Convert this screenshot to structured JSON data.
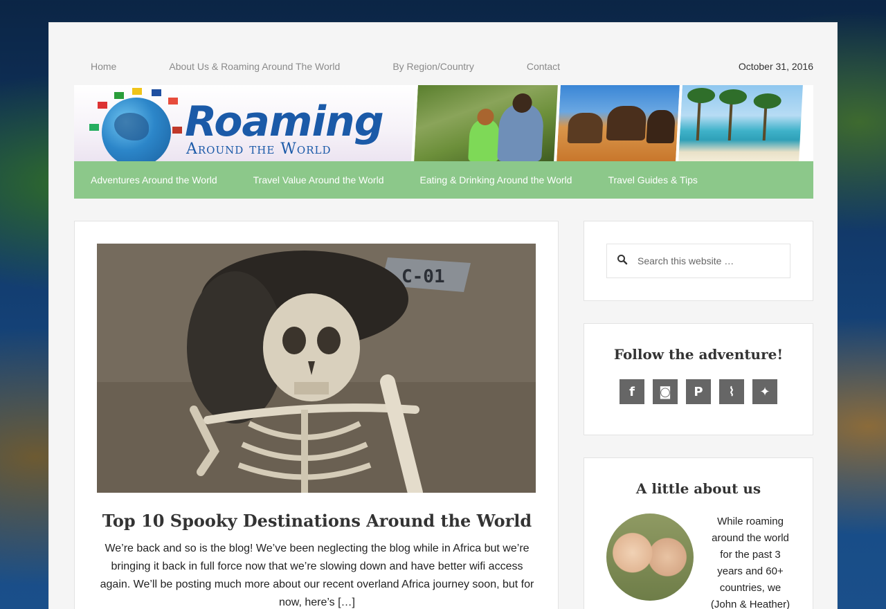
{
  "topnav": {
    "items": [
      "Home",
      "About Us & Roaming Around The World",
      "By Region/Country",
      "Contact"
    ],
    "date": "October 31, 2016"
  },
  "banner": {
    "logo_title": "Roaming",
    "logo_subtitle": "Around the World"
  },
  "mainnav": {
    "items": [
      "Adventures Around the World",
      "Travel Value Around the World",
      "Eating & Drinking Around the World",
      "Travel Guides & Tips"
    ]
  },
  "post": {
    "image_label": "C-01",
    "title": "Top 10 Spooky Destinations Around the World",
    "excerpt": "We’re back and so is the blog! We’ve been neglecting the blog while in Africa but we’re bringing it back in full force now that we’re slowing down and have better wifi access again. We’ll be posting much more about our recent overland Africa journey soon, but for now, here’s […]"
  },
  "sidebar": {
    "search": {
      "placeholder": "Search this website …",
      "icon": "search-icon"
    },
    "follow": {
      "title": "Follow the adventure!",
      "icons": [
        {
          "name": "facebook-icon",
          "glyph": "f"
        },
        {
          "name": "instagram-icon",
          "glyph": "◙"
        },
        {
          "name": "pinterest-icon",
          "glyph": "P"
        },
        {
          "name": "rss-icon",
          "glyph": "⌇"
        },
        {
          "name": "twitter-icon",
          "glyph": "✦"
        }
      ]
    },
    "about": {
      "title": "A little about us",
      "text": "While roaming around the world for the past 3 years and 60+ countries, we (John & Heather)"
    }
  },
  "colors": {
    "nav_green": "#8cc88a",
    "logo_blue": "#1b5aa8",
    "social_grey": "#666666"
  }
}
